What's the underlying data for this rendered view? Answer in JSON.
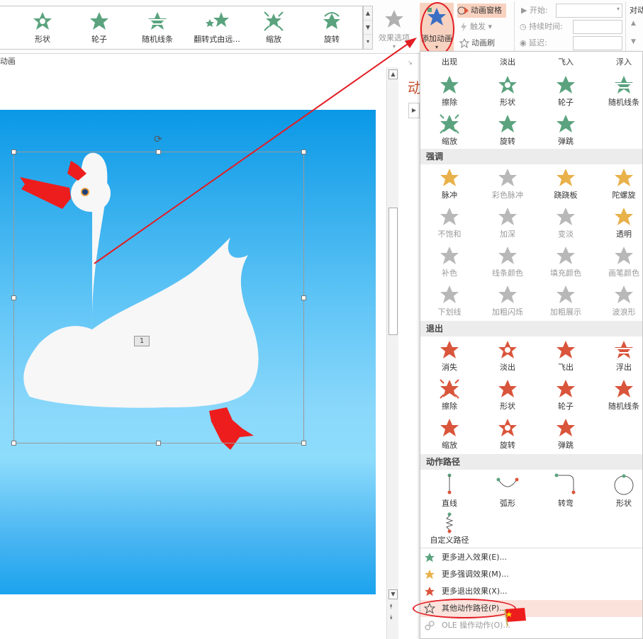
{
  "ribbon": {
    "gallery": [
      {
        "label": "形状"
      },
      {
        "label": "轮子"
      },
      {
        "label": "随机线条"
      },
      {
        "label": "翻转式由远..."
      },
      {
        "label": "缩放"
      },
      {
        "label": "旋转"
      }
    ],
    "effect_options": "效果选项",
    "add_animation": "添加动画",
    "animation_pane": "动画窗格",
    "trigger": "触发",
    "animation_painter": "动画刷",
    "start_label": "开始:",
    "duration_label": "持续时间:",
    "delay_label": "延迟:",
    "reorder_label": "对动",
    "group_label": "动画"
  },
  "pane": {
    "title": "动"
  },
  "slide": {
    "animation_tag": "1"
  },
  "dropdown": {
    "entrance_top_row": [
      "出现",
      "淡出",
      "飞入",
      "浮入"
    ],
    "entrance_rows": [
      [
        "擦除",
        "形状",
        "轮子",
        "随机线条"
      ],
      [
        "缩放",
        "旋转",
        "弹跳"
      ]
    ],
    "emphasis_title": "强调",
    "emphasis_rows": [
      [
        "脉冲",
        "彩色脉冲",
        "跷跷板",
        "陀螺旋"
      ],
      [
        "不饱和",
        "加深",
        "变淡",
        "透明"
      ],
      [
        "补色",
        "线条颜色",
        "填充颜色",
        "画笔颜色"
      ],
      [
        "下划线",
        "加粗闪烁",
        "加粗展示",
        "波浪形"
      ]
    ],
    "exit_title": "退出",
    "exit_rows": [
      [
        "消失",
        "淡出",
        "飞出",
        "浮出"
      ],
      [
        "擦除",
        "形状",
        "轮子",
        "随机线条"
      ],
      [
        "缩放",
        "旋转",
        "弹跳"
      ]
    ],
    "motion_title": "动作路径",
    "motion_row": [
      "直线",
      "弧形",
      "转弯",
      "形状"
    ],
    "custom_path": "自定义路径",
    "more": [
      {
        "label": "更多进入效果(E)..."
      },
      {
        "label": "更多强调效果(M)..."
      },
      {
        "label": "更多退出效果(X)..."
      },
      {
        "label": "其他动作路径(P)..."
      },
      {
        "label": "OLE 操作动作(O)..."
      }
    ]
  },
  "colors": {
    "entrance": "#5aa37e",
    "emphasis": "#e8b14a",
    "emphasis_dim": "#b8b8b8",
    "exit": "#d9553b",
    "highlight": "#e21d24"
  }
}
